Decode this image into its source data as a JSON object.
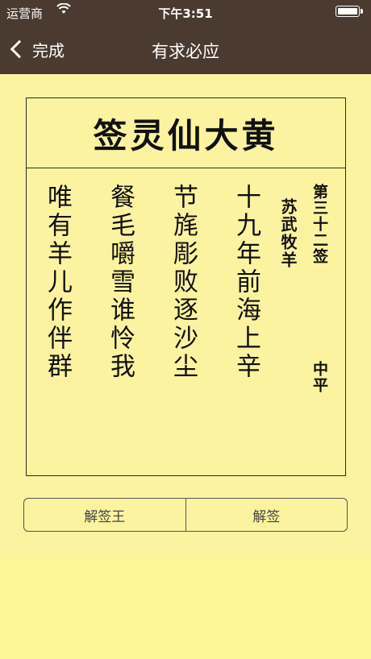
{
  "status_bar": {
    "carrier": "运营商",
    "time": "下午3:51"
  },
  "nav": {
    "back_label": "完成",
    "title": "有求必应"
  },
  "card": {
    "title": "签灵仙大黄",
    "sign_number": "第三十二签",
    "sign_level": "中平",
    "story": "苏武牧羊",
    "lines": [
      "十九年前海上辛",
      "节旄彫败逐沙尘",
      "餐毛嚼雪谁怜我",
      "唯有羊儿作伴群"
    ]
  },
  "buttons": {
    "left_label": "解签王",
    "right_label": "解签"
  },
  "colors": {
    "topbar": "#4a3a30",
    "background": "#fbf3a0",
    "text": "#111111"
  }
}
